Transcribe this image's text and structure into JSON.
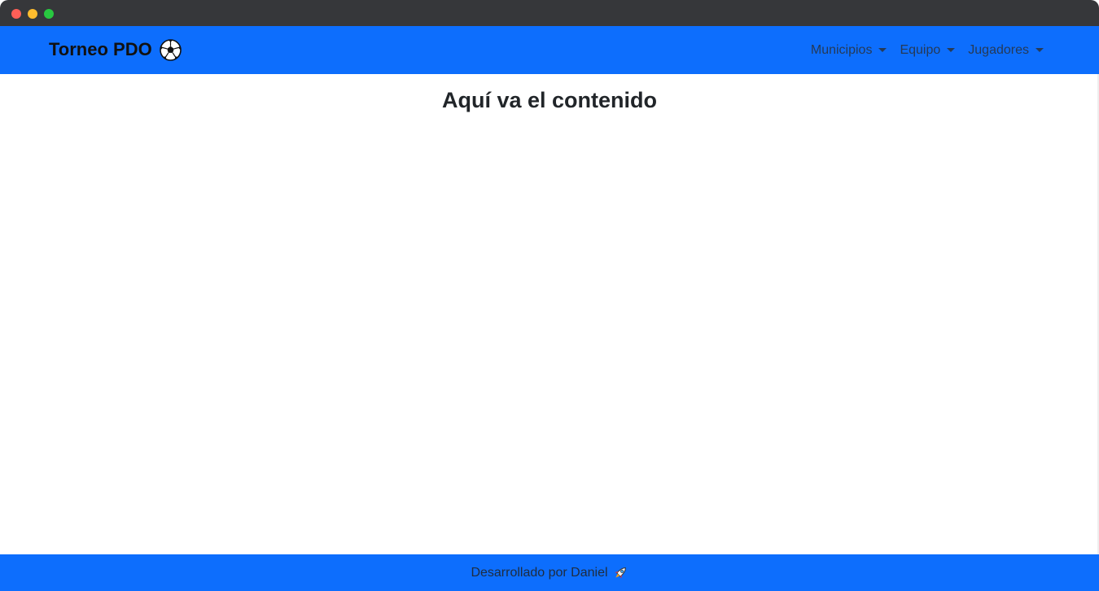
{
  "navbar": {
    "brand": "Torneo PDO",
    "brand_icon": "soccer-ball-icon",
    "menus": [
      {
        "label": "Municipios"
      },
      {
        "label": "Equipo"
      },
      {
        "label": "Jugadores"
      }
    ],
    "background": "#0d6efd"
  },
  "main": {
    "title": "Aquí va el contenido"
  },
  "footer": {
    "text": "Desarrollado por Daniel",
    "icon": "rocket-icon"
  }
}
